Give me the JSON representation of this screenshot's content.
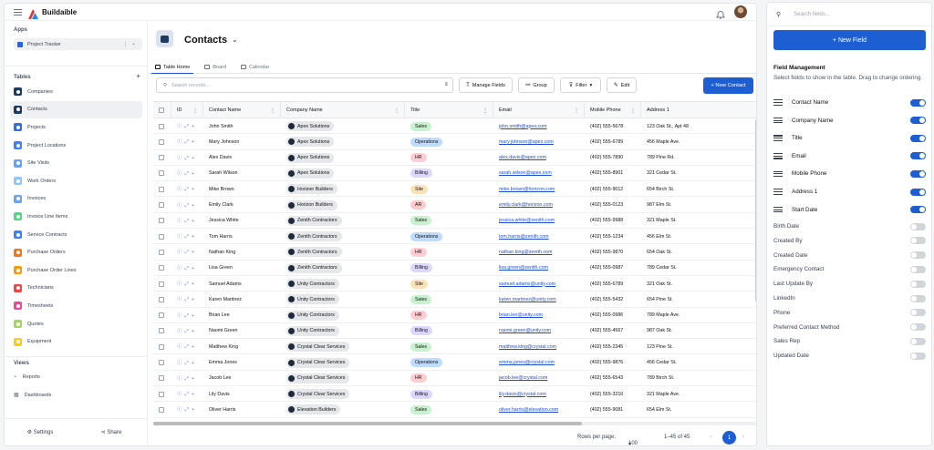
{
  "app": {
    "name": "Buildaible"
  },
  "sidebar": {
    "apps_label": "Apps",
    "app_selected": "Project Tracker",
    "tables_label": "Tables",
    "tables": [
      {
        "label": "Companies",
        "color": "#1e3a5f"
      },
      {
        "label": "Contacts",
        "color": "#1e3a5f",
        "active": true
      },
      {
        "label": "Projects",
        "color": "#2f6fde"
      },
      {
        "label": "Project Locations",
        "color": "#3b82f6"
      },
      {
        "label": "Site Visits",
        "color": "#60a5fa"
      },
      {
        "label": "Work Orders",
        "color": "#93c5fd"
      },
      {
        "label": "Invoices",
        "color": "#6ca6e8"
      },
      {
        "label": "Invoice Line Items",
        "color": "#4ade80"
      },
      {
        "label": "Service Contracts",
        "color": "#3b82f6"
      },
      {
        "label": "Purchase Orders",
        "color": "#f97316"
      },
      {
        "label": "Purchase Order Lines",
        "color": "#f59e0b"
      },
      {
        "label": "Technicians",
        "color": "#ef4444"
      },
      {
        "label": "Timesheets",
        "color": "#ec4899"
      },
      {
        "label": "Quotes",
        "color": "#a3d65c"
      },
      {
        "label": "Equipment",
        "color": "#facc15"
      }
    ],
    "views_label": "Views",
    "views": [
      {
        "label": "Reports"
      },
      {
        "label": "Dashboards"
      }
    ],
    "settings_label": "Settings",
    "share_label": "Share"
  },
  "page": {
    "title": "Contacts",
    "tabs": [
      {
        "label": "Table Home"
      },
      {
        "label": "Board"
      },
      {
        "label": "Calendar"
      }
    ],
    "search_placeholder": "Search records...",
    "manage_fields": "Manage Fields",
    "group": "Group",
    "filter": "Filter",
    "edit": "Edit",
    "new_contact": "+ New Contact"
  },
  "table": {
    "columns": [
      "ID",
      "Contact Name",
      "Company Name",
      "Title",
      "Email",
      "Mobile Phone",
      "Address 1"
    ],
    "rows": [
      {
        "name": "John Smith",
        "company": "Apex Solutions",
        "title": "Sales",
        "email": "john.smith@apex.com",
        "phone": "(402) 555-5678",
        "address": "123 Oak St., Apt 48"
      },
      {
        "name": "Mary Johnson",
        "company": "Apex Solutions",
        "title": "Operations",
        "email": "mary.johnson@apex.com",
        "phone": "(402) 555-6789",
        "address": "456 Maple Ave."
      },
      {
        "name": "Alex Davis",
        "company": "Apex Solutions",
        "title": "HR",
        "email": "alex.davis@apex.com",
        "phone": "(402) 555-7890",
        "address": "789 Pine Rd."
      },
      {
        "name": "Sarah Wilson",
        "company": "Apex Solutions",
        "title": "Billing",
        "email": "sarah.wilson@apex.com",
        "phone": "(402) 555-8901",
        "address": "321 Cedar St."
      },
      {
        "name": "Mike Brown",
        "company": "Horizon Builders",
        "title": "Site",
        "email": "mike.brown@horizon.com",
        "phone": "(402) 555-9012",
        "address": "654 Birch St."
      },
      {
        "name": "Emily Clark",
        "company": "Horizon Builders",
        "title": "AR",
        "email": "emily.clark@horizon.com",
        "phone": "(402) 555-0123",
        "address": "987 Elm St."
      },
      {
        "name": "Jessica White",
        "company": "Zenith Contractors",
        "title": "Sales",
        "email": "jessica.white@zenith.com",
        "phone": "(402) 555-9988",
        "address": "321 Maple St."
      },
      {
        "name": "Tom Harris",
        "company": "Zenith Contractors",
        "title": "Operations",
        "email": "tom.harris@zenith.com",
        "phone": "(402) 555-1234",
        "address": "456 Elm St."
      },
      {
        "name": "Nathan King",
        "company": "Zenith Contractors",
        "title": "HR",
        "email": "nathan.king@zenith.com",
        "phone": "(402) 555-9870",
        "address": "654 Oak St."
      },
      {
        "name": "Lisa Green",
        "company": "Zenith Contractors",
        "title": "Billing",
        "email": "lisa.green@zenith.com",
        "phone": "(402) 555-0987",
        "address": "789 Cedar St."
      },
      {
        "name": "Samuel Adams",
        "company": "Unity Contractors",
        "title": "Site",
        "email": "samuel.adams@unity.com",
        "phone": "(402) 555-6789",
        "address": "321 Oak St."
      },
      {
        "name": "Karen Martinez",
        "company": "Unity Contractors",
        "title": "Sales",
        "email": "karen.martinez@unity.com",
        "phone": "(402) 555-5432",
        "address": "654 Pine St."
      },
      {
        "name": "Brian Lee",
        "company": "Unity Contractors",
        "title": "HR",
        "email": "brian.lee@unity.com",
        "phone": "(402) 555-0986",
        "address": "789 Maple Ave."
      },
      {
        "name": "Naomi Green",
        "company": "Unity Contractors",
        "title": "Billing",
        "email": "naomi.green@unity.com",
        "phone": "(402) 555-4567",
        "address": "987 Oak St."
      },
      {
        "name": "Matthew King",
        "company": "Crystal Clear Services",
        "title": "Sales",
        "email": "matthew.king@crystal.com",
        "phone": "(402) 555-2345",
        "address": "123 Pine St."
      },
      {
        "name": "Emma Jones",
        "company": "Crystal Clear Services",
        "title": "Operations",
        "email": "emma.jones@crystal.com",
        "phone": "(402) 555-9876",
        "address": "456 Cedar St."
      },
      {
        "name": "Jacob Lee",
        "company": "Crystal Clear Services",
        "title": "HR",
        "email": "jacob.lee@crystal.com",
        "phone": "(402) 555-6543",
        "address": "789 Birch St."
      },
      {
        "name": "Lily Davis",
        "company": "Crystal Clear Services",
        "title": "Billing",
        "email": "lily.davis@crystal.com",
        "phone": "(402) 555-3210",
        "address": "321 Maple Ave."
      },
      {
        "name": "Oliver Harris",
        "company": "Elevation Builders",
        "title": "Sales",
        "email": "oliver.harris@elevation.com",
        "phone": "(402) 555-9081",
        "address": "654 Elm St."
      }
    ],
    "title_colors": {
      "Sales": "#c9f0cf",
      "Operations": "#bfdbfe",
      "HR": "#fecdd3",
      "Billing": "#ddd6fe",
      "Site": "#fde2b8",
      "AR": "#fecaca"
    }
  },
  "pagination": {
    "rows_per_page_label": "Rows per page:",
    "rows_per_page": "100",
    "range": "1–45 of 45",
    "current_page": "1"
  },
  "field_panel": {
    "search_placeholder": "Search fields...",
    "new_field": "+ New Field",
    "title": "Field Management",
    "description": "Select fields to show in the table. Drag to change ordering.",
    "enabled_fields": [
      "Contact Name",
      "Company Name",
      "Title",
      "Email",
      "Mobile Phone",
      "Address 1",
      "Start Date"
    ],
    "disabled_fields": [
      "Birth Date",
      "Created By",
      "Created Date",
      "Emergency Contact",
      "Last Update By",
      "LinkedIn",
      "Phone",
      "Preferred Contact Method",
      "Sales Rep",
      "Updated Date"
    ]
  }
}
